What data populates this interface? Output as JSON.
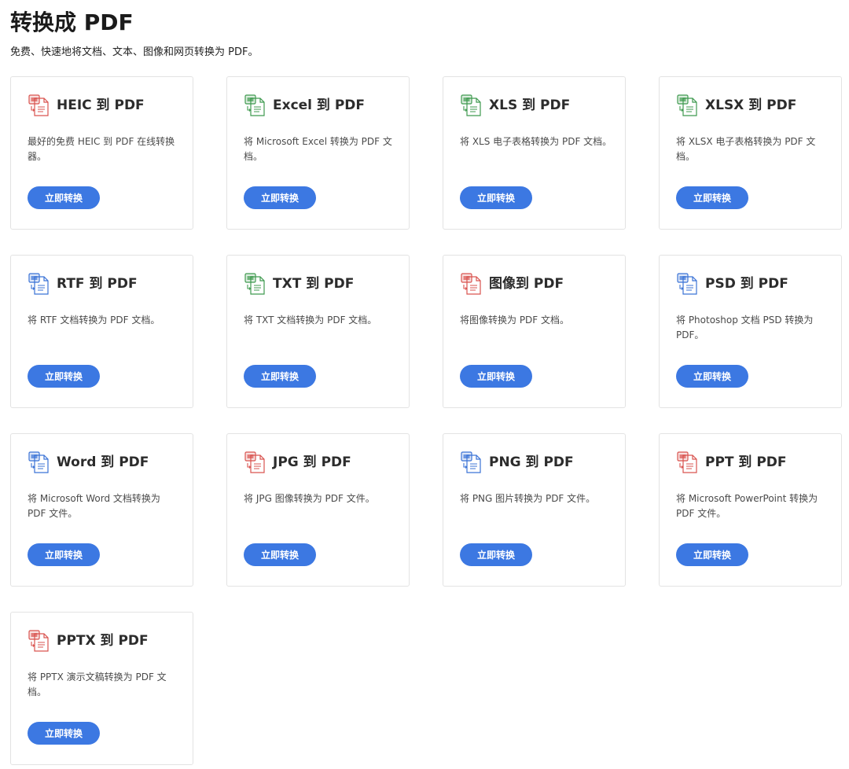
{
  "page": {
    "title": "转换成 PDF",
    "subtitle": "免费、快速地将文档、文本、图像和网页转换为 PDF。"
  },
  "button_label": "立即转换",
  "cards": [
    {
      "title": "HEIC 到 PDF",
      "desc": "最好的免费 HEIC 到 PDF 在线转换器。",
      "icon": "heic-file-icon",
      "color": "#d9534f"
    },
    {
      "title": "Excel 到 PDF",
      "desc": "将 Microsoft Excel 转换为 PDF 文档。",
      "icon": "excel-file-icon",
      "color": "#3f9a4f"
    },
    {
      "title": "XLS 到 PDF",
      "desc": "将 XLS 电子表格转换为 PDF 文档。",
      "icon": "xls-file-icon",
      "color": "#3f9a4f"
    },
    {
      "title": "XLSX 到 PDF",
      "desc": "将 XLSX 电子表格转换为 PDF 文档。",
      "icon": "xlsx-file-icon",
      "color": "#3f9a4f"
    },
    {
      "title": "RTF 到 PDF",
      "desc": "将 RTF 文档转换为 PDF 文档。",
      "icon": "rtf-file-icon",
      "color": "#3b73d6"
    },
    {
      "title": "TXT 到 PDF",
      "desc": "将 TXT 文档转换为 PDF 文档。",
      "icon": "txt-file-icon",
      "color": "#3f9a4f"
    },
    {
      "title": "图像到 PDF",
      "desc": "将图像转换为 PDF 文档。",
      "icon": "image-file-icon",
      "color": "#d9534f"
    },
    {
      "title": "PSD 到 PDF",
      "desc": "将 Photoshop 文档 PSD 转换为 PDF。",
      "icon": "psd-file-icon",
      "color": "#3b73d6"
    },
    {
      "title": "Word 到 PDF",
      "desc": "将 Microsoft Word 文档转换为 PDF 文件。",
      "icon": "word-file-icon",
      "color": "#3b73d6"
    },
    {
      "title": "JPG 到 PDF",
      "desc": "将 JPG 图像转换为 PDF 文件。",
      "icon": "jpg-file-icon",
      "color": "#d9534f"
    },
    {
      "title": "PNG 到 PDF",
      "desc": "将 PNG 图片转换为 PDF 文件。",
      "icon": "png-file-icon",
      "color": "#3b73d6"
    },
    {
      "title": "PPT 到 PDF",
      "desc": "将 Microsoft PowerPoint 转换为 PDF 文件。",
      "icon": "ppt-file-icon",
      "color": "#d9534f"
    },
    {
      "title": "PPTX 到 PDF",
      "desc": "将 PPTX 演示文稿转换为 PDF 文档。",
      "icon": "pptx-file-icon",
      "color": "#d9534f"
    }
  ]
}
